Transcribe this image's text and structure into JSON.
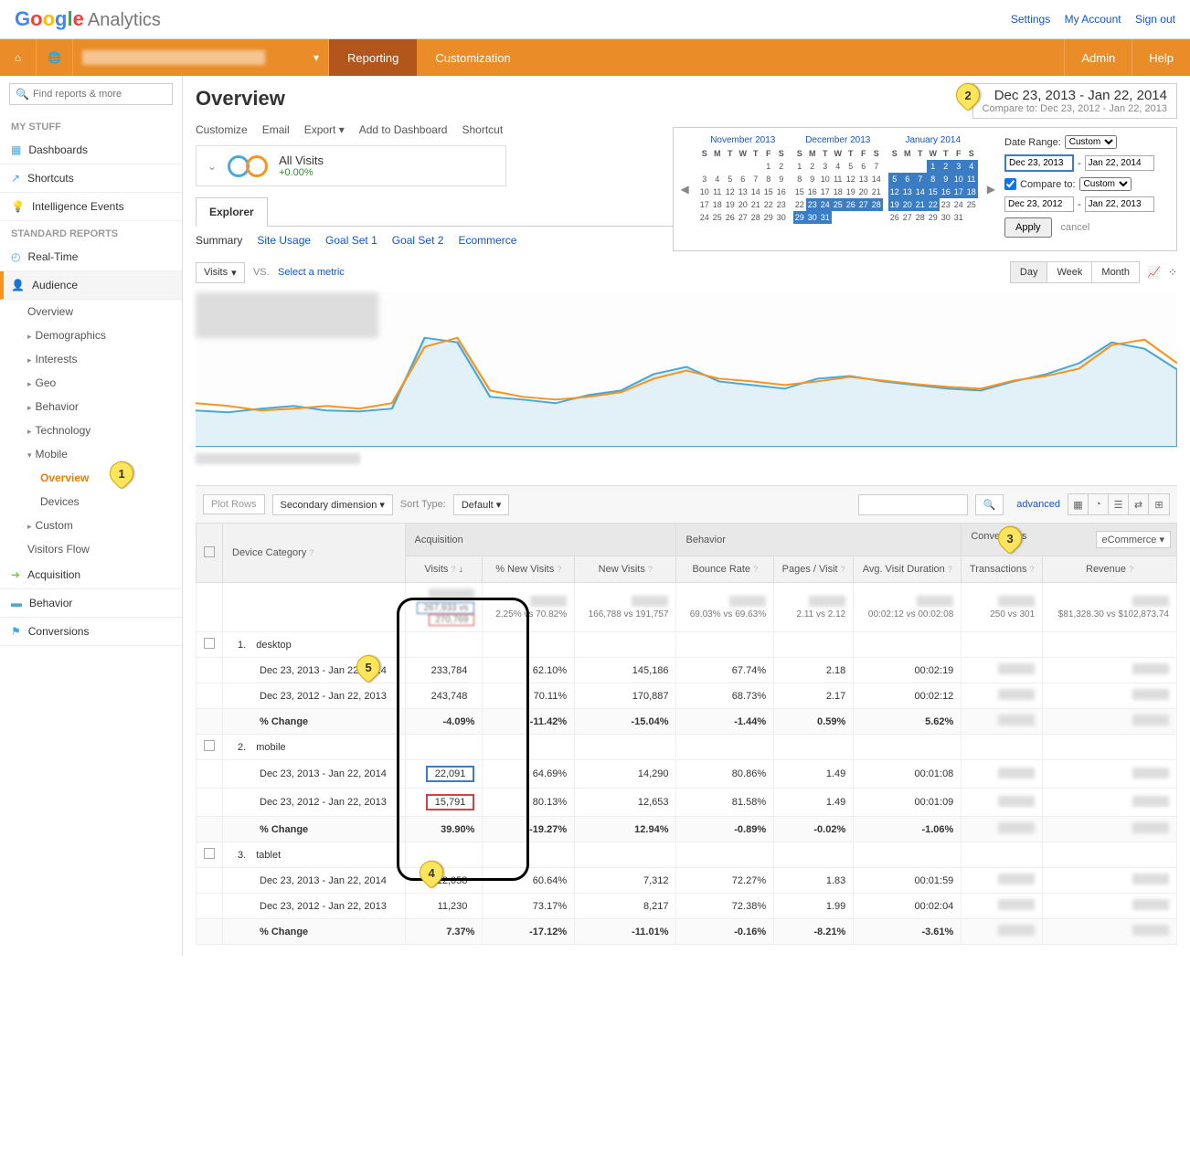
{
  "toplinks": {
    "settings": "Settings",
    "account": "My Account",
    "signout": "Sign out"
  },
  "nav": {
    "reporting": "Reporting",
    "customization": "Customization",
    "admin": "Admin",
    "help": "Help"
  },
  "search_placeholder": "Find reports & more",
  "sidebar": {
    "mystuff": "MY STUFF",
    "dashboards": "Dashboards",
    "shortcuts": "Shortcuts",
    "intelligence": "Intelligence Events",
    "standard": "STANDARD REPORTS",
    "realtime": "Real-Time",
    "audience": "Audience",
    "overview": "Overview",
    "demographics": "Demographics",
    "interests": "Interests",
    "geo": "Geo",
    "behavior": "Behavior",
    "technology": "Technology",
    "mobile": "Mobile",
    "mobile_overview": "Overview",
    "devices": "Devices",
    "custom": "Custom",
    "visitors_flow": "Visitors Flow",
    "acquisition": "Acquisition",
    "behavior_main": "Behavior",
    "conversions": "Conversions"
  },
  "page_title": "Overview",
  "date_range": {
    "primary": "Dec 23, 2013 - Jan 22, 2014",
    "compare_prefix": "Compare to:",
    "compare": "Dec 23, 2012 - Jan 22, 2013"
  },
  "actions": {
    "customize": "Customize",
    "email": "Email",
    "export": "Export",
    "addto": "Add to Dashboard",
    "shortcut": "Shortcut"
  },
  "segment": {
    "name": "All Visits",
    "pct": "+0.00%"
  },
  "datepanel": {
    "months": [
      "November 2013",
      "December 2013",
      "January 2014"
    ],
    "range_label": "Date Range:",
    "custom": "Custom",
    "start": "Dec 23, 2013",
    "end": "Jan 22, 2014",
    "compare_to": "Compare to:",
    "cstart": "Dec 23, 2012",
    "cend": "Jan 22, 2013",
    "apply": "Apply",
    "cancel": "cancel"
  },
  "explorer": "Explorer",
  "subtabs": {
    "summary": "Summary",
    "site_usage": "Site Usage",
    "goal1": "Goal Set 1",
    "goal2": "Goal Set 2",
    "ecommerce": "Ecommerce"
  },
  "metric": {
    "visits": "Visits",
    "vs": "VS.",
    "select": "Select a metric"
  },
  "view": {
    "day": "Day",
    "week": "Week",
    "month": "Month"
  },
  "table_controls": {
    "plot": "Plot Rows",
    "secondary": "Secondary dimension",
    "sort": "Sort Type:",
    "default": "Default",
    "advanced": "advanced"
  },
  "columns": {
    "device": "Device Category",
    "acquisition": "Acquisition",
    "behavior": "Behavior",
    "conversions": "Conversions",
    "ecommerce": "eCommerce",
    "visits": "Visits",
    "new_visits_pct": "% New Visits",
    "new_visits": "New Visits",
    "bounce": "Bounce Rate",
    "pages": "Pages / Visit",
    "duration": "Avg. Visit Duration",
    "transactions": "Transactions",
    "revenue": "Revenue"
  },
  "summary_row": {
    "visits_a": "267,933 vs",
    "visits_b": "270,769",
    "new_pct": "2.25% vs 70.82%",
    "new": "166,788 vs 191,757",
    "bounce": "69.03% vs 69.63%",
    "pages": "2.11 vs 2.12",
    "dur": "00:02:12 vs 00:02:08",
    "trans": "250 vs 301",
    "rev": "$81,328.30 vs $102,873.74"
  },
  "period1": "Dec 23, 2013 - Jan 22, 2014",
  "period2": "Dec 23, 2012 - Jan 22, 2013",
  "change": "% Change",
  "rows": [
    {
      "idx": "1.",
      "name": "desktop",
      "p1": {
        "visits": "233,784",
        "newpct": "62.10%",
        "new": "145,186",
        "bounce": "67.74%",
        "pages": "2.18",
        "dur": "00:02:19"
      },
      "p2": {
        "visits": "243,748",
        "newpct": "70.11%",
        "new": "170,887",
        "bounce": "68.73%",
        "pages": "2.17",
        "dur": "00:02:12"
      },
      "chg": {
        "visits": "-4.09%",
        "newpct": "-11.42%",
        "new": "-15.04%",
        "bounce": "-1.44%",
        "pages": "0.59%",
        "dur": "5.62%"
      }
    },
    {
      "idx": "2.",
      "name": "mobile",
      "p1": {
        "visits": "22,091",
        "newpct": "64.69%",
        "new": "14,290",
        "bounce": "80.86%",
        "pages": "1.49",
        "dur": "00:01:08"
      },
      "p2": {
        "visits": "15,791",
        "newpct": "80.13%",
        "new": "12,653",
        "bounce": "81.58%",
        "pages": "1.49",
        "dur": "00:01:09"
      },
      "chg": {
        "visits": "39.90%",
        "newpct": "-19.27%",
        "new": "12.94%",
        "bounce": "-0.89%",
        "pages": "-0.02%",
        "dur": "-1.06%"
      }
    },
    {
      "idx": "3.",
      "name": "tablet",
      "p1": {
        "visits": "12,058",
        "newpct": "60.64%",
        "new": "7,312",
        "bounce": "72.27%",
        "pages": "1.83",
        "dur": "00:01:59"
      },
      "p2": {
        "visits": "11,230",
        "newpct": "73.17%",
        "new": "8,217",
        "bounce": "72.38%",
        "pages": "1.99",
        "dur": "00:02:04"
      },
      "chg": {
        "visits": "7.37%",
        "newpct": "-17.12%",
        "new": "-11.01%",
        "bounce": "-0.16%",
        "pages": "-8.21%",
        "dur": "-3.61%"
      }
    }
  ],
  "annotations": {
    "a1": "1",
    "a2": "2",
    "a3": "3",
    "a4": "4",
    "a5": "5"
  },
  "chart_data": {
    "type": "line",
    "series": [
      {
        "name": "Dec 23, 2013 - Jan 22, 2014",
        "color": "#4AA8D8",
        "values": [
          6000,
          5800,
          6200,
          6500,
          6000,
          5900,
          6100,
          12000,
          11500,
          7000,
          6800,
          6500,
          7200,
          7500,
          8500,
          9000,
          8000,
          7800,
          7600,
          8200,
          8400,
          8000,
          7800,
          7600,
          7500,
          8000,
          8500,
          9200,
          11000,
          10500,
          9000
        ]
      },
      {
        "name": "Dec 23, 2012 - Jan 22, 2013",
        "color": "#F7941E",
        "values": [
          6500,
          6300,
          6000,
          6200,
          6400,
          6100,
          6500,
          11000,
          12000,
          7500,
          7000,
          6800,
          7000,
          7400,
          8200,
          8800,
          8200,
          8000,
          7800,
          8000,
          8300,
          8100,
          7900,
          7700,
          7600,
          8100,
          8400,
          9000,
          10800,
          11200,
          9500
        ]
      }
    ]
  }
}
